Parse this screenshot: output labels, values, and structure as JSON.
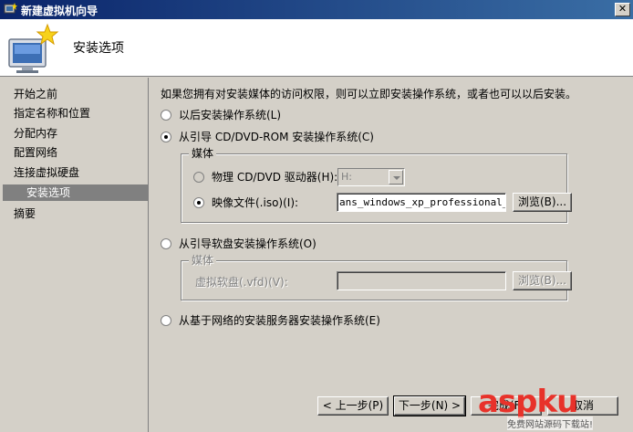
{
  "window": {
    "title": "新建虚拟机向导",
    "close_label": "✕"
  },
  "header": {
    "page_title": "安装选项"
  },
  "sidebar": {
    "items": [
      {
        "label": "开始之前"
      },
      {
        "label": "指定名称和位置"
      },
      {
        "label": "分配内存"
      },
      {
        "label": "配置网络"
      },
      {
        "label": "连接虚拟硬盘"
      },
      {
        "label": "安装选项",
        "active": true
      },
      {
        "label": "摘要"
      }
    ]
  },
  "main": {
    "intro": "如果您拥有对安装媒体的访问权限，则可以立即安装操作系统，或者也可以以后安装。",
    "option_later": {
      "label": "以后安装操作系统(L)",
      "selected": false
    },
    "option_cd": {
      "label": "从引导 CD/DVD-ROM 安装操作系统(C)",
      "selected": true,
      "group_label": "媒体",
      "physical": {
        "label": "物理 CD/DVD 驱动器(H):",
        "selected": false,
        "drive_value": "H:"
      },
      "image": {
        "label": "映像文件(.iso)(I):",
        "selected": true,
        "path_value": "ans_windows_xp_professional_wit",
        "browse_label": "浏览(B)..."
      }
    },
    "option_floppy": {
      "label": "从引导软盘安装操作系统(O)",
      "selected": false,
      "group_label": "媒体",
      "vfd": {
        "label": "虚拟软盘(.vfd)(V):",
        "value": "",
        "browse_label": "浏览(B)..."
      }
    },
    "option_network": {
      "label": "从基于网络的安装服务器安装操作系统(E)",
      "selected": false
    }
  },
  "footer": {
    "prev_label": "< 上一步(P)",
    "next_label": "下一步(N) >",
    "finish_label": "完成(F)",
    "cancel_label": "取消"
  },
  "watermark": {
    "main": "aspku",
    "sub": "免费网站源码下载站!"
  },
  "colors": {
    "title_start": "#0a246a",
    "title_end": "#3a6ea5",
    "selected_nav": "#808080",
    "watermark": "#e8322a"
  },
  "icons": {
    "app": "wizard-app-icon",
    "wizard": "monitor-with-star-icon"
  }
}
